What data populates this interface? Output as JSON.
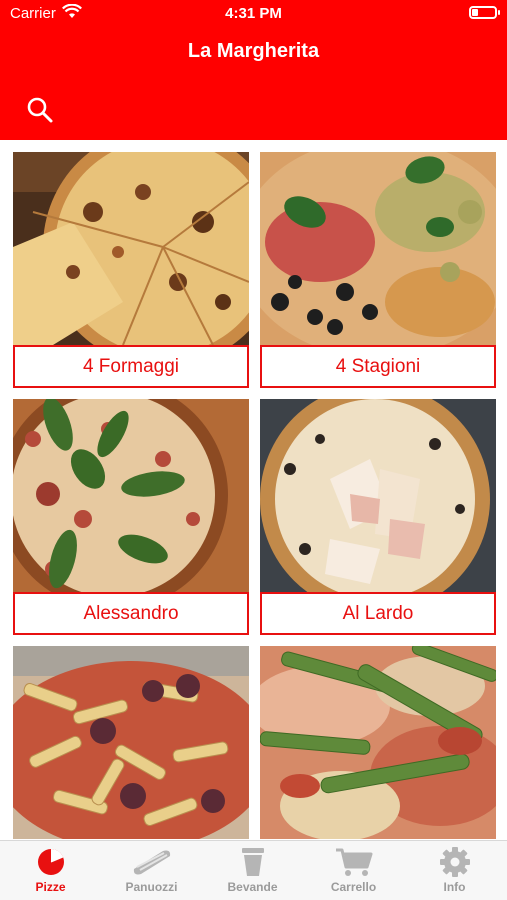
{
  "status_bar": {
    "carrier": "Carrier",
    "time": "4:31 PM"
  },
  "header": {
    "title": "La Margherita"
  },
  "colors": {
    "accent": "#ff0000",
    "label_border": "#e81010",
    "inactive_tab": "#9b9b9b"
  },
  "pizzas": [
    {
      "name": "4 Formaggi",
      "photo": "pizza-4-formaggi-photo"
    },
    {
      "name": "4 Stagioni",
      "photo": "pizza-4-stagioni-photo"
    },
    {
      "name": "Alessandro",
      "photo": "pizza-alessandro-photo"
    },
    {
      "name": "Al Lardo",
      "photo": "pizza-al-lardo-photo"
    },
    {
      "name": "",
      "photo": "pizza-penne-photo"
    },
    {
      "name": "",
      "photo": "pizza-asparagi-photo"
    }
  ],
  "tabs": [
    {
      "label": "Pizze",
      "icon": "pizza-icon",
      "active": true
    },
    {
      "label": "Panuozzi",
      "icon": "sandwich-icon",
      "active": false
    },
    {
      "label": "Bevande",
      "icon": "cup-icon",
      "active": false
    },
    {
      "label": "Carrello",
      "icon": "cart-icon",
      "active": false
    },
    {
      "label": "Info",
      "icon": "gear-icon",
      "active": false
    }
  ]
}
